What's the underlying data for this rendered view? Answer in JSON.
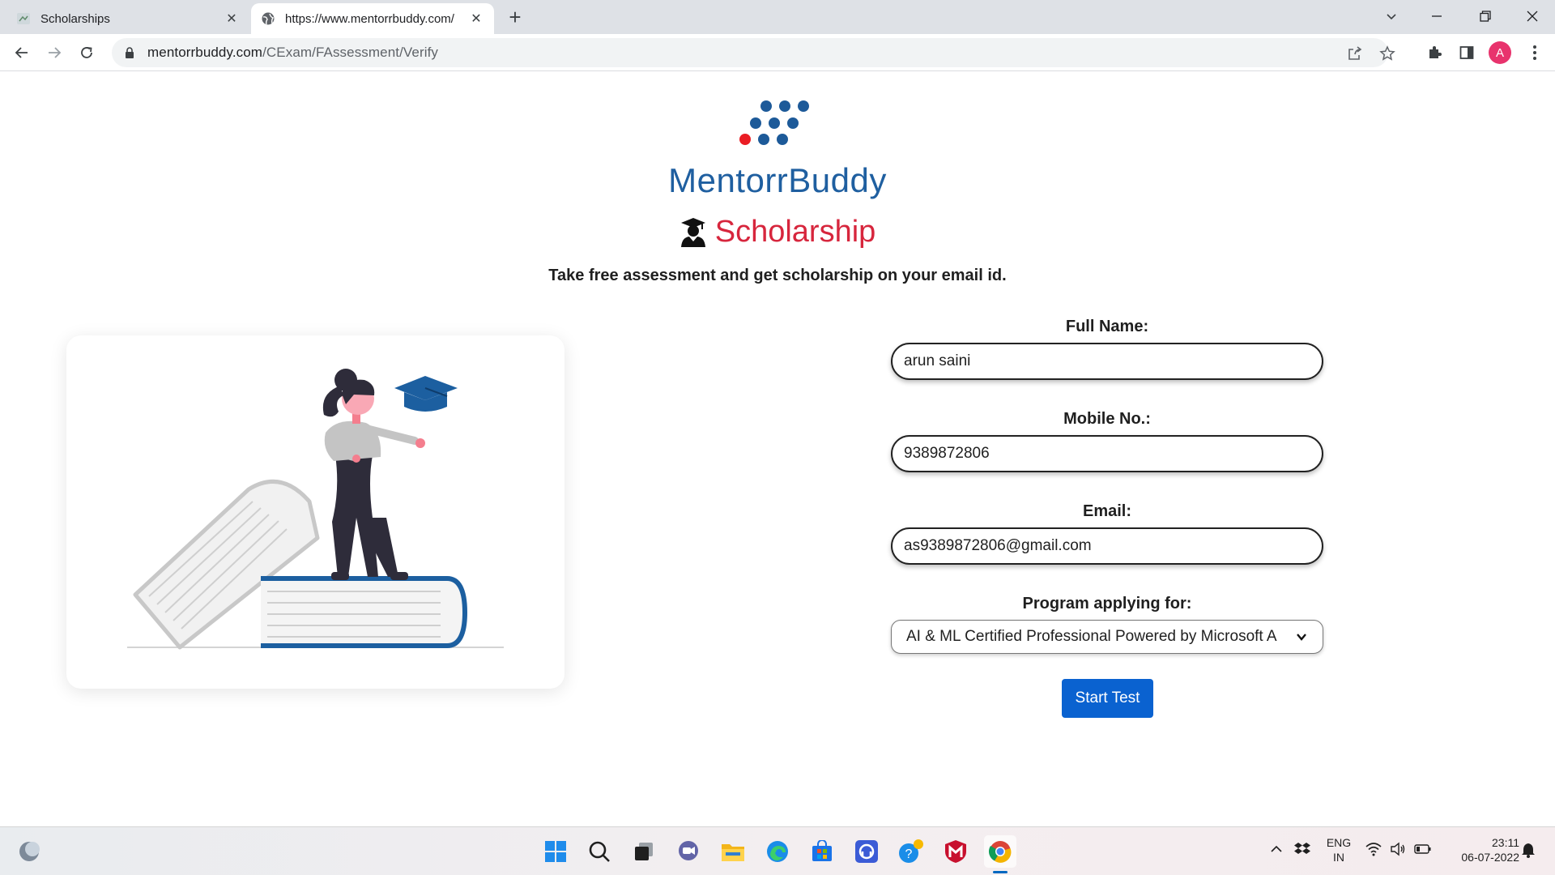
{
  "browser": {
    "tabs": [
      {
        "title": "Scholarships",
        "active": false
      },
      {
        "title": "https://www.mentorrbuddy.com/",
        "active": true
      }
    ],
    "new_tab_label": "+",
    "url_host": "mentorrbuddy.com",
    "url_path": "/CExam/FAssessment/Verify",
    "profile_initial": "A",
    "colors": {
      "tabbar": "#dee1e6",
      "omnibox": "#f1f3f4",
      "avatar": "#e8336d"
    }
  },
  "page": {
    "brand": {
      "name": "MentorrBuddy",
      "color": "#1f5fa0",
      "logo_icon": "dots-logo-icon"
    },
    "scholarship": {
      "title": "Scholarship",
      "icon": "graduate-icon",
      "color": "#d7263d"
    },
    "tagline": "Take free assessment and get scholarship on your email id.",
    "illustration": "woman-on-books-illustration",
    "form": {
      "full_name": {
        "label": "Full Name:",
        "value": "arun saini"
      },
      "mobile": {
        "label": "Mobile No.:",
        "value": "9389872806"
      },
      "email": {
        "label": "Email:",
        "value": "as9389872806@gmail.com"
      },
      "program": {
        "label": "Program applying for:",
        "value": "AI & ML Certified Professional Powered by Microsoft A"
      },
      "submit_label": "Start Test",
      "submit_color": "#0a62d0"
    }
  },
  "taskbar": {
    "apps": [
      "weather-icon",
      "start-icon",
      "search-icon",
      "task-view-icon",
      "chat-icon",
      "file-explorer-icon",
      "edge-icon",
      "store-icon",
      "app-icon",
      "help-icon",
      "mcafee-icon",
      "chrome-icon"
    ],
    "active_app": "chrome-icon",
    "language_line1": "ENG",
    "language_line2": "IN",
    "time": "23:11",
    "date": "06-07-2022"
  }
}
